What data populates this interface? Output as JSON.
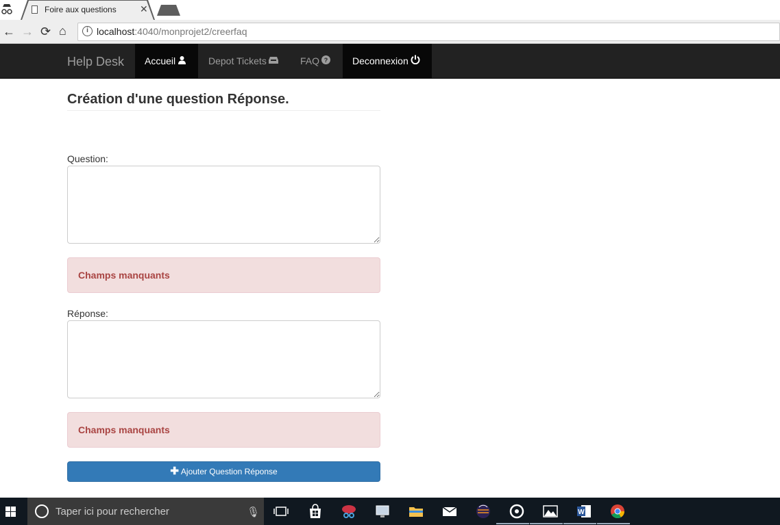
{
  "browser": {
    "tab_title": "Foire aux questions",
    "tab_close": "✕",
    "url_host": "localhost",
    "url_rest": ":4040/monprojet2/creerfaq",
    "back": "←",
    "forward": "→",
    "reload": "⟳",
    "home": "⌂",
    "info": "i"
  },
  "navbar": {
    "brand": "Help Desk",
    "items": [
      {
        "label": "Accueil",
        "icon": "user-icon",
        "glyph": "👤"
      },
      {
        "label": "Depot Tickets",
        "icon": "inbox-icon",
        "glyph": "📥"
      },
      {
        "label": "FAQ",
        "icon": "question-circle-icon",
        "glyph": "❓"
      },
      {
        "label": "Deconnexion",
        "icon": "power-icon",
        "glyph": "⏻"
      }
    ]
  },
  "main": {
    "title": "Création d'une question Réponse.",
    "question_label": "Question:",
    "question_value": "",
    "question_error": "Champs manquants",
    "reponse_label": "Réponse:",
    "reponse_value": "",
    "reponse_error": "Champs manquants",
    "submit_plus": "✚",
    "submit_label": "Ajouter Question Réponse"
  },
  "taskbar": {
    "search_placeholder": "Taper ici pour rechercher",
    "mic": "🎙"
  },
  "colors": {
    "navbar_bg": "#222222",
    "navbar_active": "#080808",
    "alert_bg": "#f2dede",
    "alert_text": "#a94442",
    "button_primary": "#337ab7"
  }
}
